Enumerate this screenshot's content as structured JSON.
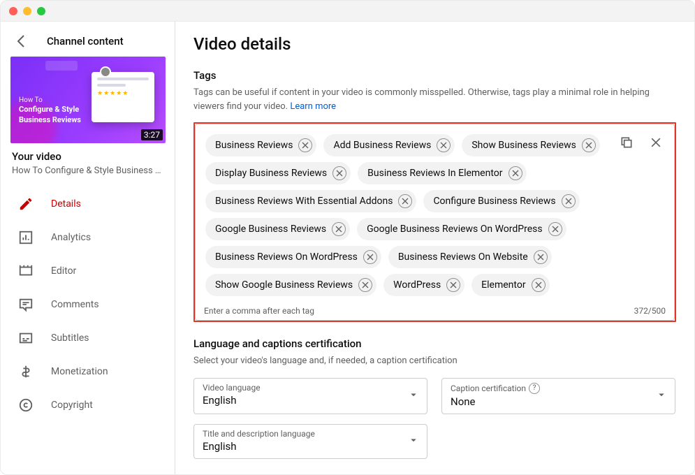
{
  "sidebar": {
    "back_label": "Channel content",
    "thumbnail": {
      "line1": "How To",
      "line2": "Configure & Style",
      "line3": "Business Reviews",
      "duration": "3:27"
    },
    "your_video_label": "Your video",
    "video_title": "How To Configure & Style Business …",
    "items": [
      {
        "id": "details",
        "label": "Details",
        "active": true
      },
      {
        "id": "analytics",
        "label": "Analytics",
        "active": false
      },
      {
        "id": "editor",
        "label": "Editor",
        "active": false
      },
      {
        "id": "comments",
        "label": "Comments",
        "active": false
      },
      {
        "id": "subtitles",
        "label": "Subtitles",
        "active": false
      },
      {
        "id": "monetization",
        "label": "Monetization",
        "active": false
      },
      {
        "id": "copyright",
        "label": "Copyright",
        "active": false
      }
    ]
  },
  "main": {
    "page_title": "Video details",
    "tags": {
      "heading": "Tags",
      "description": "Tags can be useful if content in your video is commonly misspelled. Otherwise, tags play a minimal role in helping viewers find your video. ",
      "learn_more": "Learn more",
      "items": [
        "Business Reviews",
        "Add Business Reviews",
        "Show Business Reviews",
        "Display Business Reviews",
        "Business Reviews In Elementor",
        "Business Reviews With Essential Addons",
        "Configure Business Reviews",
        "Google Business Reviews",
        "Google Business Reviews On WordPress",
        "Business Reviews On WordPress",
        "Business Reviews On Website",
        "Show Google Business Reviews",
        "WordPress",
        "Elementor"
      ],
      "hint": "Enter a comma after each tag",
      "counter": "372/500"
    },
    "language": {
      "heading": "Language and captions certification",
      "description": "Select your video's language and, if needed, a caption certification",
      "video_language_label": "Video language",
      "video_language_value": "English",
      "caption_cert_label": "Caption certification",
      "caption_cert_value": "None",
      "title_desc_lang_label": "Title and description language",
      "title_desc_lang_value": "English"
    }
  }
}
